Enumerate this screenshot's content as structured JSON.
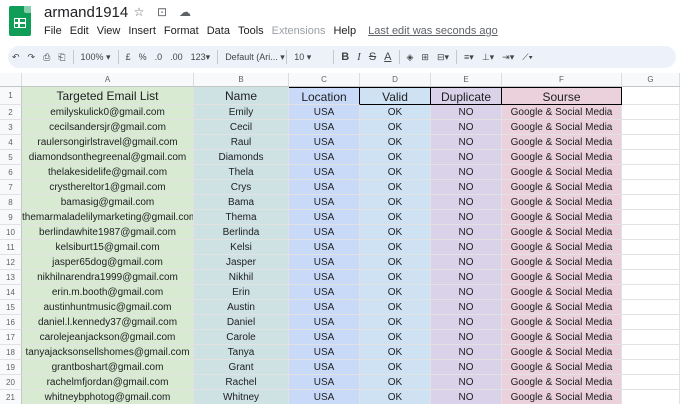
{
  "app": {
    "title": "armand1914",
    "menus": [
      "File",
      "Edit",
      "View",
      "Insert",
      "Format",
      "Data",
      "Tools",
      "Extensions",
      "Help"
    ],
    "last_edit": "Last edit was seconds ago"
  },
  "toolbar": {
    "zoom": "100%",
    "currency": "£",
    "percent": "%",
    "dec_decrease": ".0",
    "dec_increase": ".00",
    "number_format": "123",
    "font": "Default (Ari...",
    "font_size": "10",
    "bold": "B",
    "italic": "I",
    "strike": "S",
    "text_color": "A"
  },
  "columns": [
    "A",
    "B",
    "C",
    "D",
    "E",
    "F",
    "G"
  ],
  "header_row": {
    "email": "Targeted Email List",
    "name": "Name",
    "location": "Location",
    "valid": "Valid",
    "duplicate": "Duplicate",
    "source": "Sourse"
  },
  "rows": [
    {
      "n": "2",
      "email": "emilyskulick0@gmail.com",
      "name": "Emily",
      "location": "USA",
      "valid": "OK",
      "duplicate": "NO",
      "source": "Google & Social Media"
    },
    {
      "n": "3",
      "email": "cecilsandersjr@gmail.com",
      "name": "Cecil",
      "location": "USA",
      "valid": "OK",
      "duplicate": "NO",
      "source": "Google & Social Media"
    },
    {
      "n": "4",
      "email": "raulersongirlstravel@gmail.com",
      "name": "Raul",
      "location": "USA",
      "valid": "OK",
      "duplicate": "NO",
      "source": "Google & Social Media"
    },
    {
      "n": "5",
      "email": "diamondsonthegreenal@gmail.com",
      "name": "Diamonds",
      "location": "USA",
      "valid": "OK",
      "duplicate": "NO",
      "source": "Google & Social Media"
    },
    {
      "n": "6",
      "email": "thelakesidelife@gmail.com",
      "name": "Thela",
      "location": "USA",
      "valid": "OK",
      "duplicate": "NO",
      "source": "Google & Social Media"
    },
    {
      "n": "7",
      "email": "crysthereltor1@gmail.com",
      "name": "Crys",
      "location": "USA",
      "valid": "OK",
      "duplicate": "NO",
      "source": "Google & Social Media"
    },
    {
      "n": "8",
      "email": "bamasig@gmail.com",
      "name": "Bama",
      "location": "USA",
      "valid": "OK",
      "duplicate": "NO",
      "source": "Google & Social Media"
    },
    {
      "n": "9",
      "email": "themarmaladelilymarketing@gmail.com",
      "name": "Thema",
      "location": "USA",
      "valid": "OK",
      "duplicate": "NO",
      "source": "Google & Social Media"
    },
    {
      "n": "10",
      "email": "berlindawhite1987@gmail.com",
      "name": "Berlinda",
      "location": "USA",
      "valid": "OK",
      "duplicate": "NO",
      "source": "Google & Social Media"
    },
    {
      "n": "11",
      "email": "kelsiburt15@gmail.com",
      "name": "Kelsi",
      "location": "USA",
      "valid": "OK",
      "duplicate": "NO",
      "source": "Google & Social Media"
    },
    {
      "n": "12",
      "email": "jasper65dog@gmail.com",
      "name": "Jasper",
      "location": "USA",
      "valid": "OK",
      "duplicate": "NO",
      "source": "Google & Social Media"
    },
    {
      "n": "13",
      "email": "nikhilnarendra1999@gmail.com",
      "name": "Nikhil",
      "location": "USA",
      "valid": "OK",
      "duplicate": "NO",
      "source": "Google & Social Media"
    },
    {
      "n": "14",
      "email": "erin.m.booth@gmail.com",
      "name": "Erin",
      "location": "USA",
      "valid": "OK",
      "duplicate": "NO",
      "source": "Google & Social Media"
    },
    {
      "n": "15",
      "email": "austinhuntmusic@gmail.com",
      "name": "Austin",
      "location": "USA",
      "valid": "OK",
      "duplicate": "NO",
      "source": "Google & Social Media"
    },
    {
      "n": "16",
      "email": "daniel.l.kennedy37@gmail.com",
      "name": "Daniel",
      "location": "USA",
      "valid": "OK",
      "duplicate": "NO",
      "source": "Google & Social Media"
    },
    {
      "n": "17",
      "email": "carolejeanjackson@gmail.com",
      "name": "Carole",
      "location": "USA",
      "valid": "OK",
      "duplicate": "NO",
      "source": "Google & Social Media"
    },
    {
      "n": "18",
      "email": "tanyajacksonsellshomes@gmail.com",
      "name": "Tanya",
      "location": "USA",
      "valid": "OK",
      "duplicate": "NO",
      "source": "Google & Social Media"
    },
    {
      "n": "19",
      "email": "grantboshart@gmail.com",
      "name": "Grant",
      "location": "USA",
      "valid": "OK",
      "duplicate": "NO",
      "source": "Google & Social Media"
    },
    {
      "n": "20",
      "email": "rachelmfjordan@gmail.com",
      "name": "Rachel",
      "location": "USA",
      "valid": "OK",
      "duplicate": "NO",
      "source": "Google & Social Media"
    },
    {
      "n": "21",
      "email": "whitneybphotog@gmail.com",
      "name": "Whitney",
      "location": "USA",
      "valid": "OK",
      "duplicate": "NO",
      "source": "Google & Social Media"
    }
  ]
}
